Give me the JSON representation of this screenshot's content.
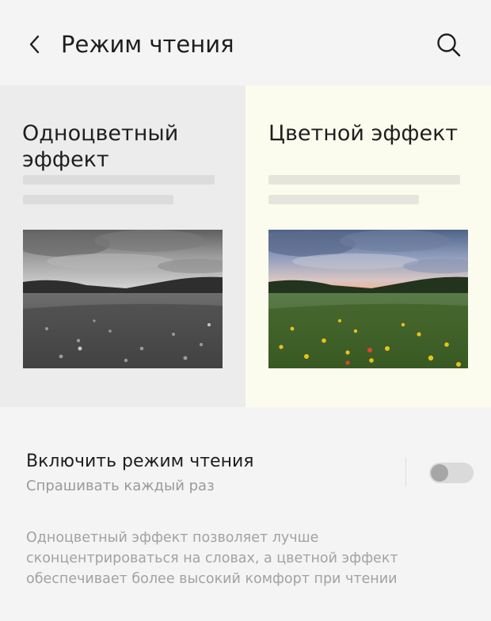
{
  "header": {
    "title": "Режим чтения",
    "back_icon": "chevron-left-icon",
    "search_icon": "search-icon"
  },
  "panels": {
    "monochrome": {
      "title": "Одноцветный эффект",
      "background": "#ececec",
      "image": "grayscale-meadow-photo"
    },
    "color": {
      "title": "Цветной эффект",
      "background": "#fcfcee",
      "image": "color-meadow-photo"
    }
  },
  "setting": {
    "title": "Включить режим чтения",
    "subtitle": "Спрашивать каждый раз",
    "toggle_on": false
  },
  "description": "Одноцветный эффект позволяет лучше сконцентрироваться на словах, а цветной эффект обеспечивает более высокий комфорт при чтении"
}
